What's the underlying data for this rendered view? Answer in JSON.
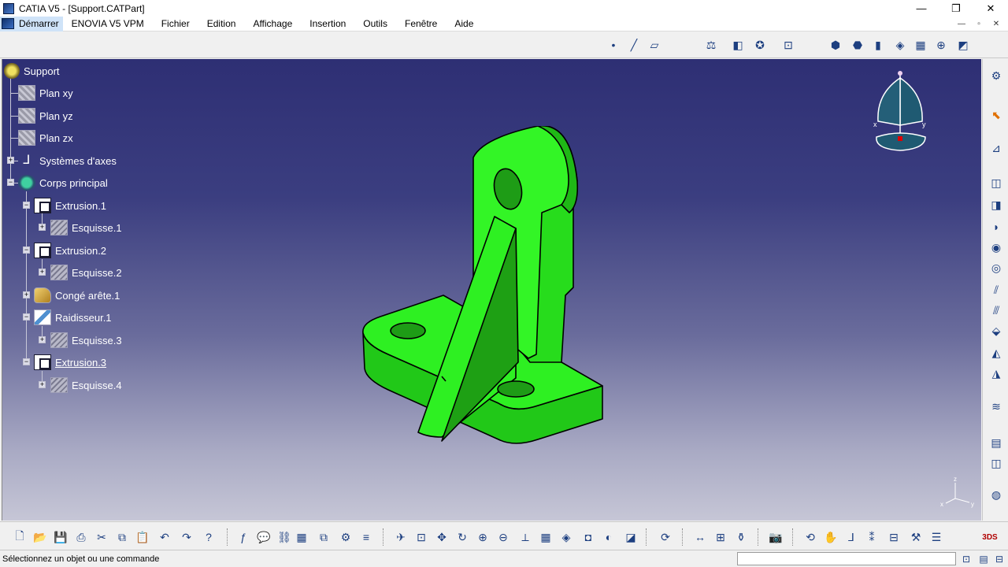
{
  "window": {
    "title": "CATIA V5 - [Support.CATPart]",
    "minimize": "—",
    "maximize": "❐",
    "close": "✕"
  },
  "menu": {
    "start": "Démarrer",
    "items": [
      "ENOVIA V5 VPM",
      "Fichier",
      "Edition",
      "Affichage",
      "Insertion",
      "Outils",
      "Fenêtre",
      "Aide"
    ],
    "mdi": [
      "—",
      "▫",
      "✕"
    ]
  },
  "tree": {
    "root": "Support",
    "planes": [
      "Plan xy",
      "Plan yz",
      "Plan zx"
    ],
    "axis_systems": "Systèmes d'axes",
    "body": "Corps principal",
    "features": [
      {
        "label": "Extrusion.1",
        "icon": "pad-icon",
        "sketch": "Esquisse.1"
      },
      {
        "label": "Extrusion.2",
        "icon": "pad-icon",
        "sketch": "Esquisse.2"
      },
      {
        "label": "Congé arête.1",
        "icon": "fillet-icon"
      },
      {
        "label": "Raidisseur.1",
        "icon": "rib-icon",
        "sketch": "Esquisse.3"
      },
      {
        "label": "Extrusion.3",
        "icon": "pad-icon",
        "sketch": "Esquisse.4",
        "active": true
      }
    ]
  },
  "compass": {
    "x": "x",
    "y": "y"
  },
  "miniaxis": {
    "z": "z",
    "x": "x",
    "y": "y"
  },
  "part_color": "#22e61c",
  "status": {
    "message": "Sélectionnez un objet ou une commande",
    "command_input": ""
  }
}
